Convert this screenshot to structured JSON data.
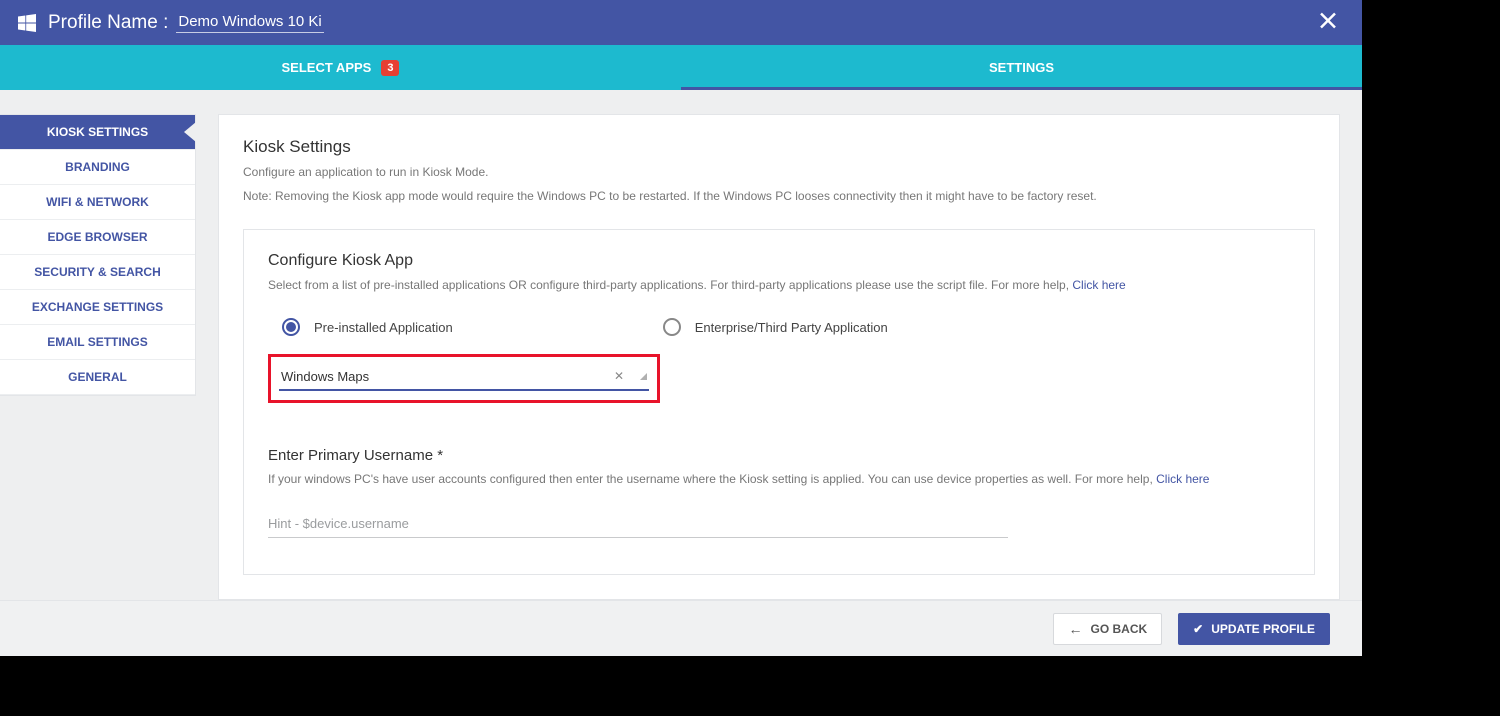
{
  "header": {
    "profile_label": "Profile Name :",
    "profile_name": "Demo Windows 10 Ki"
  },
  "tabs": {
    "select_apps": "SELECT APPS",
    "select_apps_badge": "3",
    "settings": "SETTINGS"
  },
  "sidebar": {
    "items": [
      {
        "label": "KIOSK SETTINGS",
        "active": true
      },
      {
        "label": "BRANDING"
      },
      {
        "label": "WIFI & NETWORK"
      },
      {
        "label": "EDGE BROWSER"
      },
      {
        "label": "SECURITY & SEARCH"
      },
      {
        "label": "EXCHANGE SETTINGS"
      },
      {
        "label": "EMAIL SETTINGS"
      },
      {
        "label": "GENERAL"
      }
    ]
  },
  "main": {
    "title": "Kiosk Settings",
    "desc1": "Configure an application to run in Kiosk Mode.",
    "desc2": "Note: Removing the Kiosk app mode would require the Windows PC to be restarted. If the Windows PC looses connectivity then it might have to be factory reset.",
    "panel": {
      "title": "Configure Kiosk App",
      "help_pre": "Select from a list of pre-installed applications OR configure third-party applications. For third-party applications please use the script file. For more help, ",
      "help_link": "Click here",
      "radio1": "Pre-installed Application",
      "radio2": "Enterprise/Third Party Application",
      "dropdown_value": "Windows Maps",
      "username_title": "Enter Primary Username *",
      "username_help_pre": "If your windows PC's have user accounts configured then enter the username where the Kiosk setting is applied. You can use device properties as well. For more help, ",
      "username_help_link": "Click here",
      "username_placeholder": "Hint - $device.username"
    }
  },
  "footer": {
    "back": "GO BACK",
    "save": "UPDATE PROFILE"
  }
}
